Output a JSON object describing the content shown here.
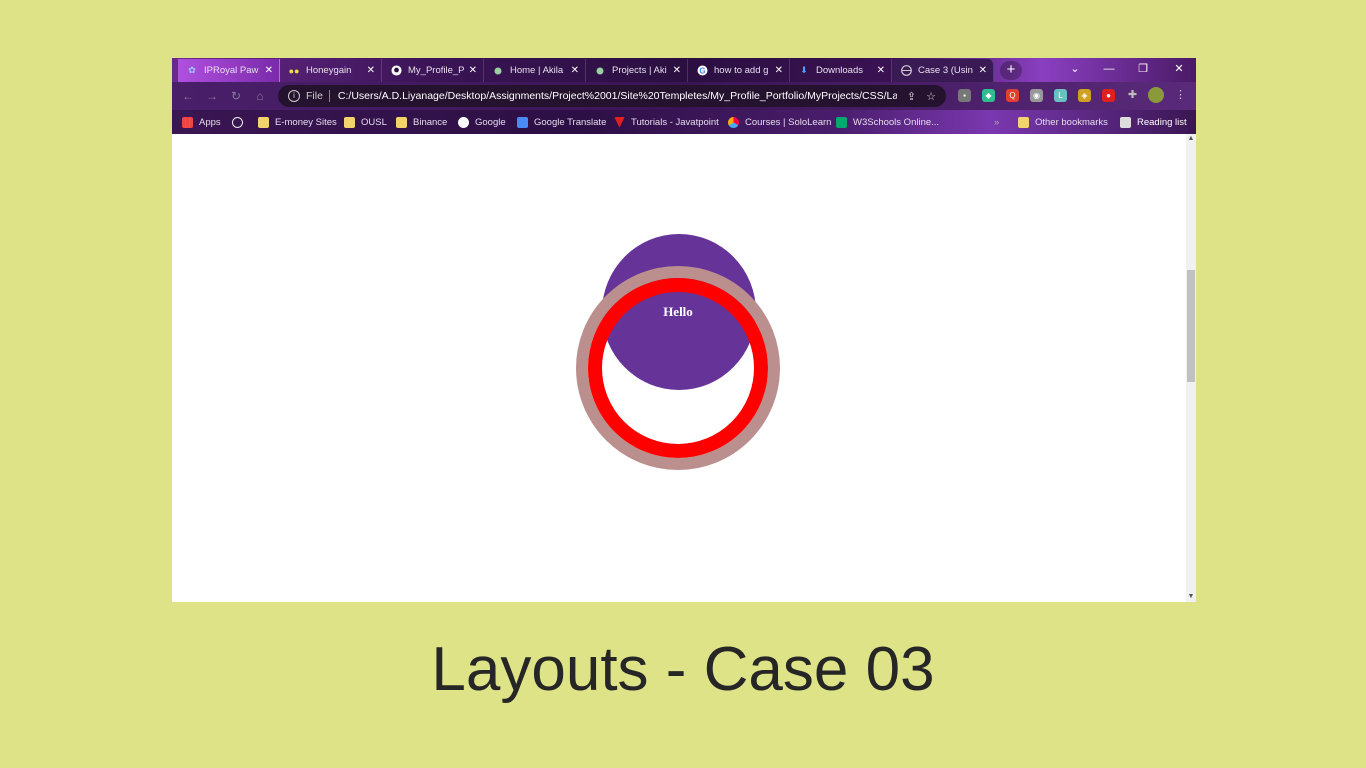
{
  "tabs": [
    {
      "title": "IPRoyal Paw",
      "favicon": "paw-icon",
      "color": "#7ab0ff"
    },
    {
      "title": "Honeygain",
      "favicon": "honeygain-icon",
      "color": "#f0e040"
    },
    {
      "title": "My_Profile_P",
      "favicon": "github-icon",
      "color": "#ffffff"
    },
    {
      "title": "Home | Akila",
      "favicon": "site-icon",
      "color": "#9ad0a0"
    },
    {
      "title": "Projects | Aki",
      "favicon": "site-icon",
      "color": "#9ad0a0"
    },
    {
      "title": "how to add g",
      "favicon": "google-icon",
      "color": "#ffffff"
    },
    {
      "title": "Downloads",
      "favicon": "download-icon",
      "color": "#4aa0ff"
    },
    {
      "title": "Case 3 (Usin",
      "favicon": "globe-icon",
      "color": "#cfcfcf"
    }
  ],
  "address": {
    "scheme": "File",
    "url": "C:/Users/A.D.Liyanage/Desktop/Assignments/Project%2001/Site%20Templetes/My_Profile_Portfolio/MyProjects/CSS/Lay..."
  },
  "bookmarks": [
    {
      "label": "Apps",
      "icon": "apps-grid-icon"
    },
    {
      "label": "",
      "icon": "gauge-icon"
    },
    {
      "label": "E-money Sites",
      "icon": "folder-icon"
    },
    {
      "label": "OUSL",
      "icon": "folder-icon"
    },
    {
      "label": "Binance",
      "icon": "folder-icon"
    },
    {
      "label": "Google",
      "icon": "google-icon"
    },
    {
      "label": "Google Translate",
      "icon": "translate-icon"
    },
    {
      "label": "Tutorials - Javatpoint",
      "icon": "javatpoint-icon"
    },
    {
      "label": "Courses | SoloLearn",
      "icon": "sololearn-icon"
    },
    {
      "label": "W3Schools Online...",
      "icon": "w3schools-icon"
    }
  ],
  "bookmarks_overflow": "»",
  "other_bookmarks": "Other bookmarks",
  "reading_list": "Reading list",
  "page": {
    "hello_text": "Hello",
    "colors": {
      "purple": "#663399",
      "outer_ring": "#bc8f8f",
      "inner_ring": "#ff0000"
    }
  },
  "caption": "Layouts - Case 03"
}
